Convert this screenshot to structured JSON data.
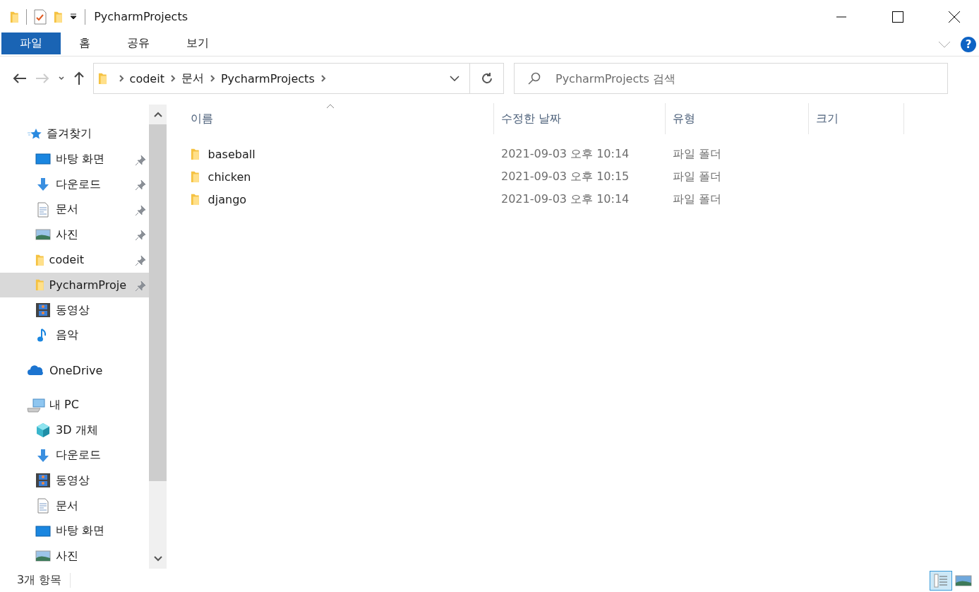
{
  "window": {
    "title": "PycharmProjects"
  },
  "ribbon": {
    "tabs": [
      {
        "label": "파일",
        "selected": true
      },
      {
        "label": "홈",
        "selected": false
      },
      {
        "label": "공유",
        "selected": false
      },
      {
        "label": "보기",
        "selected": false
      }
    ],
    "help": "?"
  },
  "address": {
    "path": [
      "codeit",
      "문서",
      "PycharmProjects"
    ]
  },
  "search": {
    "placeholder": "PycharmProjects 검색"
  },
  "sidebar": {
    "sections": [
      {
        "label": "즐겨찾기",
        "kind": "star",
        "children": [
          {
            "label": "바탕 화면",
            "kind": "desktop",
            "pinned": true,
            "selected": false
          },
          {
            "label": "다운로드",
            "kind": "download",
            "pinned": true,
            "selected": false
          },
          {
            "label": "문서",
            "kind": "document",
            "pinned": true,
            "selected": false
          },
          {
            "label": "사진",
            "kind": "picture",
            "pinned": true,
            "selected": false
          },
          {
            "label": "codeit",
            "kind": "folder",
            "pinned": true,
            "selected": false
          },
          {
            "label": "PycharmProje",
            "kind": "folder",
            "pinned": true,
            "selected": true
          },
          {
            "label": "동영상",
            "kind": "video",
            "pinned": false,
            "selected": false
          },
          {
            "label": "음악",
            "kind": "music",
            "pinned": false,
            "selected": false
          }
        ]
      },
      {
        "label": "OneDrive",
        "kind": "cloud"
      },
      {
        "label": "내 PC",
        "kind": "pc",
        "children": [
          {
            "label": "3D 개체",
            "kind": "cube",
            "pinned": false,
            "selected": false
          },
          {
            "label": "다운로드",
            "kind": "download",
            "pinned": false,
            "selected": false
          },
          {
            "label": "동영상",
            "kind": "video",
            "pinned": false,
            "selected": false
          },
          {
            "label": "문서",
            "kind": "document",
            "pinned": false,
            "selected": false
          },
          {
            "label": "바탕 화면",
            "kind": "desktop",
            "pinned": false,
            "selected": false
          },
          {
            "label": "사진",
            "kind": "picture",
            "pinned": false,
            "selected": false
          }
        ]
      }
    ]
  },
  "table": {
    "columns": [
      {
        "label": "이름",
        "sorted": true
      },
      {
        "label": "수정한 날짜",
        "sorted": false
      },
      {
        "label": "유형",
        "sorted": false
      },
      {
        "label": "크기",
        "sorted": false
      }
    ],
    "rows": [
      {
        "name": "baseball",
        "modified": "2021-09-03 오후 10:14",
        "type": "파일 폴더"
      },
      {
        "name": "chicken",
        "modified": "2021-09-03 오후 10:15",
        "type": "파일 폴더"
      },
      {
        "name": "django",
        "modified": "2021-09-03 오후 10:14",
        "type": "파일 폴더"
      }
    ]
  },
  "status_bar": {
    "count": "3개 항목",
    "views": [
      {
        "kind": "details",
        "selected": true
      },
      {
        "kind": "thumbnails",
        "selected": false
      }
    ]
  }
}
